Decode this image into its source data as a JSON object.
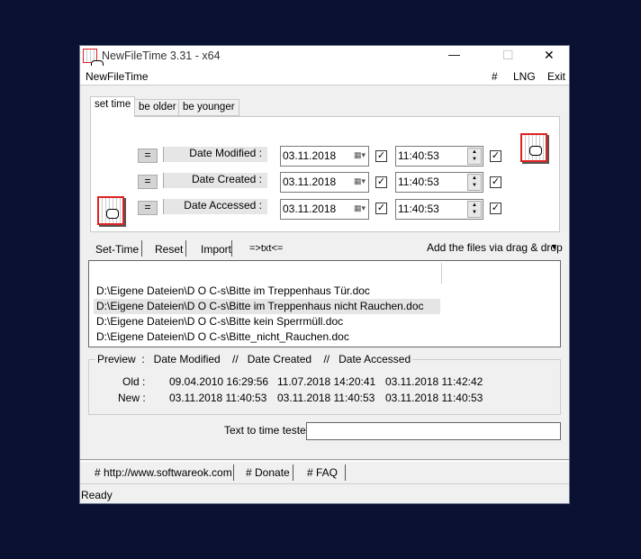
{
  "window": {
    "title": "NewFileTime 3.31 - x64",
    "minimize": "—",
    "maximize": "☐",
    "close": "✕"
  },
  "menu": {
    "app": "NewFileTime",
    "hash": "#",
    "lng": "LNG",
    "exit": "Exit"
  },
  "tabs": [
    "set time",
    "be older",
    "be younger"
  ],
  "rows": [
    {
      "label": "Date Modified :",
      "date": "03.11.2018",
      "time": "11:40:53"
    },
    {
      "label": "Date Created :",
      "date": "03.11.2018",
      "time": "11:40:53"
    },
    {
      "label": "Date Accessed :",
      "date": "03.11.2018",
      "time": "11:40:53"
    }
  ],
  "eq_label": "=",
  "check": "✓",
  "toolbar": {
    "set_time": "Set-Time",
    "reset": "Reset",
    "import": "Import",
    "txt": "=>txt<=",
    "drag": "Add the files via drag & drop",
    "arrow": "▼"
  },
  "files": [
    "D:\\Eigene Dateien\\D O C-s\\Bitte im Treppenhaus Tür.doc",
    "D:\\Eigene Dateien\\D O C-s\\Bitte im Treppenhaus nicht Rauchen.doc",
    "D:\\Eigene Dateien\\D O C-s\\Bitte kein Sperrmüll.doc",
    "D:\\Eigene Dateien\\D O C-s\\Bitte_nicht_Rauchen.doc"
  ],
  "preview": {
    "legend": "Preview  :   Date Modified    //   Date Created    //   Date Accessed",
    "old_label": "Old :",
    "new_label": "New :",
    "old": [
      "09.04.2010 16:29:56",
      "11.07.2018 14:20:41",
      "03.11.2018 11:42:42"
    ],
    "new": [
      "03.11.2018 11:40:53",
      "03.11.2018 11:40:53",
      "03.11.2018 11:40:53"
    ]
  },
  "tester": {
    "label": "Text to time tester",
    "value": ""
  },
  "links": [
    "# http://www.softwareok.com",
    "# Donate",
    "# FAQ"
  ],
  "status": "Ready"
}
